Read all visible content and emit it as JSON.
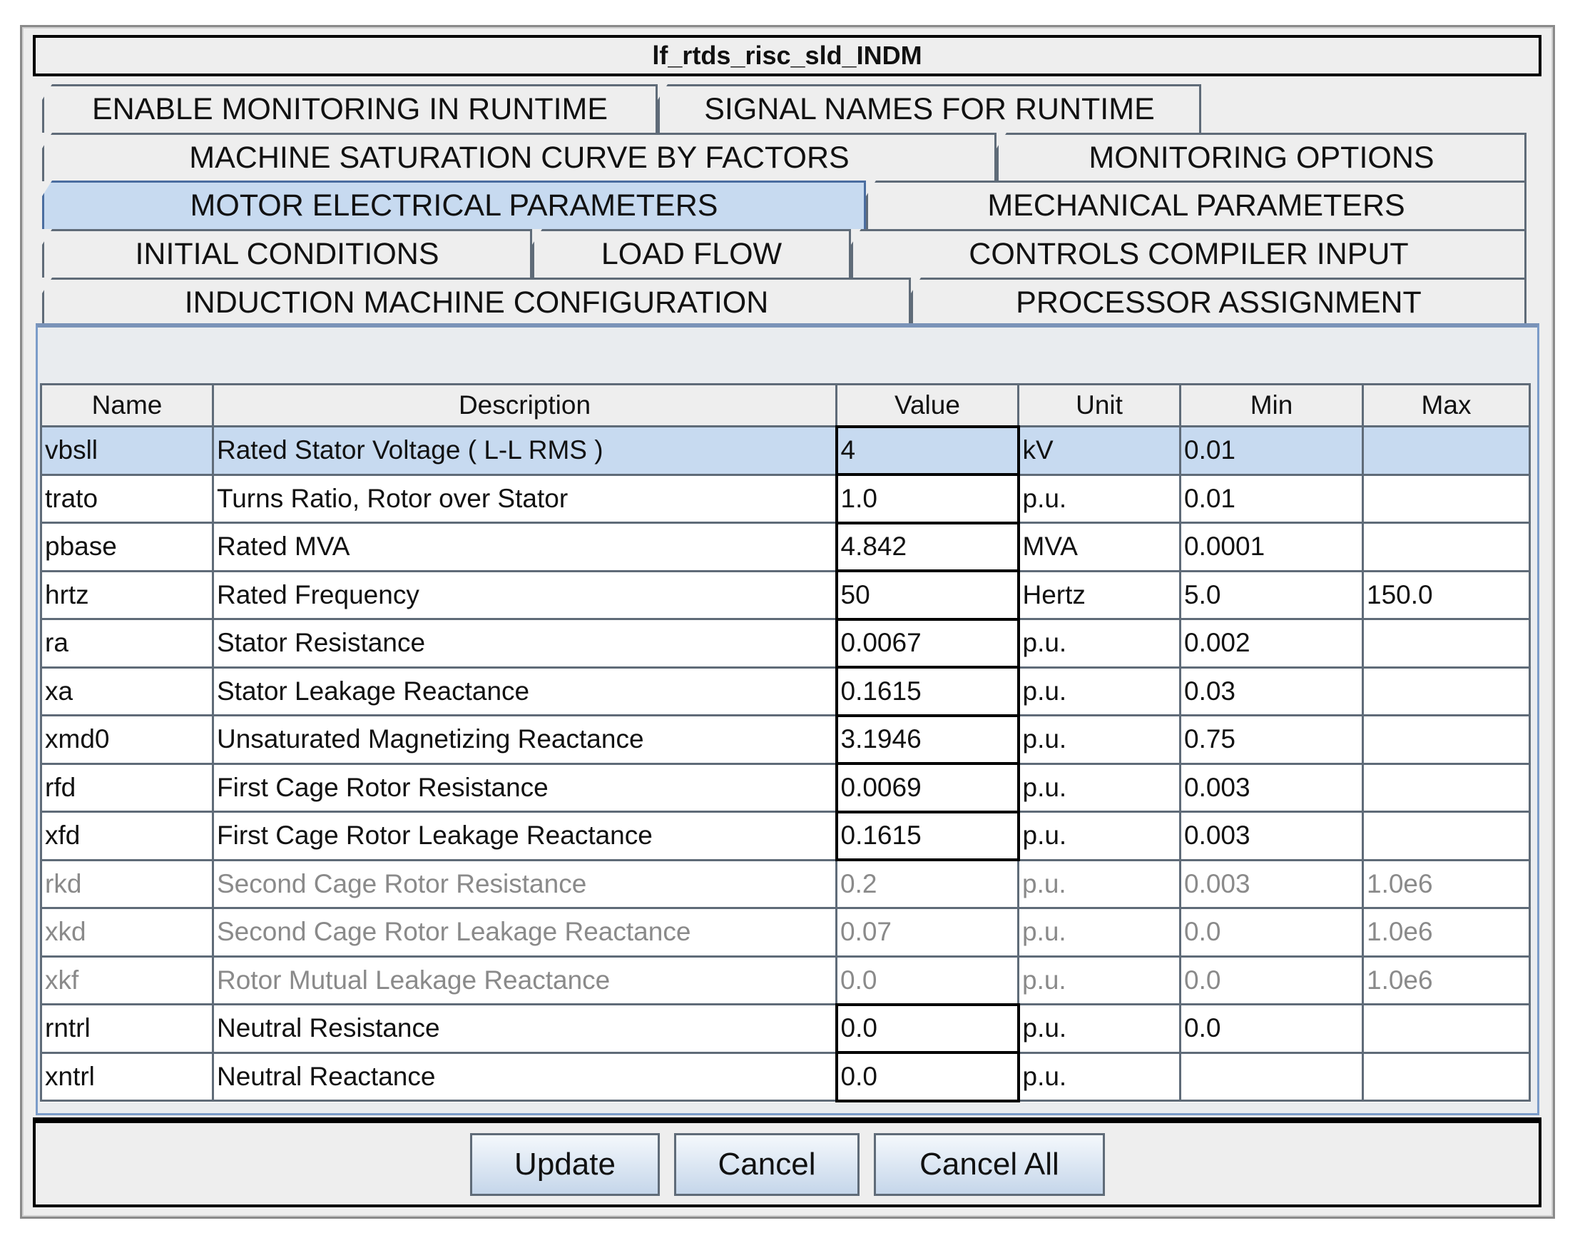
{
  "window": {
    "title": "lf_rtds_risc_sld_INDM"
  },
  "tabs": [
    {
      "label": "ENABLE MONITORING IN RUNTIME"
    },
    {
      "label": "SIGNAL NAMES FOR RUNTIME"
    },
    {
      "label": "MACHINE SATURATION CURVE BY FACTORS"
    },
    {
      "label": "MONITORING OPTIONS"
    },
    {
      "label": "MOTOR ELECTRICAL PARAMETERS",
      "selected": true
    },
    {
      "label": "MECHANICAL PARAMETERS"
    },
    {
      "label": "INITIAL CONDITIONS"
    },
    {
      "label": "LOAD FLOW"
    },
    {
      "label": "CONTROLS COMPILER INPUT"
    },
    {
      "label": "INDUCTION MACHINE CONFIGURATION"
    },
    {
      "label": "PROCESSOR ASSIGNMENT"
    }
  ],
  "table": {
    "columns": [
      "Name",
      "Description",
      "Value",
      "Unit",
      "Min",
      "Max"
    ],
    "rows": [
      {
        "name": "vbsll",
        "desc": "Rated Stator Voltage   ( L-L RMS )",
        "value": "4",
        "unit": "kV",
        "min": "0.01",
        "max": "",
        "state": "selected"
      },
      {
        "name": "trato",
        "desc": "Turns Ratio, Rotor over Stator",
        "value": "1.0",
        "unit": "p.u.",
        "min": "0.01",
        "max": "",
        "state": "edit"
      },
      {
        "name": "pbase",
        "desc": "Rated MVA",
        "value": "4.842",
        "unit": "MVA",
        "min": "0.0001",
        "max": "",
        "state": "edit"
      },
      {
        "name": "hrtz",
        "desc": "Rated Frequency",
        "value": "50",
        "unit": "Hertz",
        "min": "5.0",
        "max": "150.0",
        "state": "edit"
      },
      {
        "name": "ra",
        "desc": "Stator Resistance",
        "value": "0.0067",
        "unit": "p.u.",
        "min": "0.002",
        "max": "",
        "state": "edit"
      },
      {
        "name": "xa",
        "desc": "Stator Leakage Reactance",
        "value": "0.1615",
        "unit": "p.u.",
        "min": "0.03",
        "max": "",
        "state": "edit"
      },
      {
        "name": "xmd0",
        "desc": "Unsaturated Magnetizing Reactance",
        "value": "3.1946",
        "unit": "p.u.",
        "min": "0.75",
        "max": "",
        "state": "edit"
      },
      {
        "name": "rfd",
        "desc": "First Cage Rotor Resistance",
        "value": "0.0069",
        "unit": "p.u.",
        "min": "0.003",
        "max": "",
        "state": "edit"
      },
      {
        "name": "xfd",
        "desc": "First Cage Rotor Leakage Reactance",
        "value": "0.1615",
        "unit": "p.u.",
        "min": "0.003",
        "max": "",
        "state": "edit"
      },
      {
        "name": "rkd",
        "desc": "Second Cage Rotor Resistance",
        "value": "0.2",
        "unit": "p.u.",
        "min": "0.003",
        "max": "1.0e6",
        "state": "disabled"
      },
      {
        "name": "xkd",
        "desc": "Second Cage Rotor Leakage Reactance",
        "value": "0.07",
        "unit": "p.u.",
        "min": "0.0",
        "max": "1.0e6",
        "state": "disabled"
      },
      {
        "name": "xkf",
        "desc": "Rotor Mutual Leakage Reactance",
        "value": "0.0",
        "unit": "p.u.",
        "min": "0.0",
        "max": "1.0e6",
        "state": "disabled"
      },
      {
        "name": "rntrl",
        "desc": "Neutral Resistance",
        "value": "0.0",
        "unit": "p.u.",
        "min": "0.0",
        "max": "",
        "state": "edit"
      },
      {
        "name": "xntrl",
        "desc": "Neutral Reactance",
        "value": "0.0",
        "unit": "p.u.",
        "min": "",
        "max": "",
        "state": "edit"
      }
    ]
  },
  "buttons": {
    "update": "Update",
    "cancel": "Cancel",
    "cancel_all": "Cancel All"
  }
}
